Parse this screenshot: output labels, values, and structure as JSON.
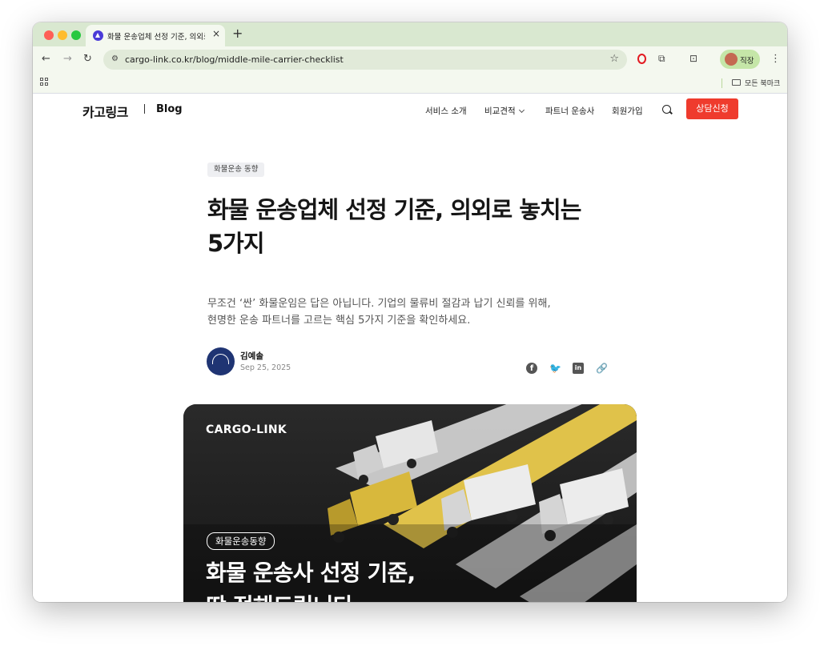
{
  "browser": {
    "tab_title": "화물 운송업체 선정 기준, 의외로 놓",
    "tab_close": "×",
    "new_tab": "+",
    "url": "cargo-link.co.kr/blog/middle-mile-carrier-checklist",
    "profile_name": "직장",
    "bookmarks_folder": "모든 북마크",
    "icons": {
      "back": "←",
      "forward": "→",
      "reload": "↻",
      "site_info": "⚙",
      "star": "☆",
      "extensions": "⧉",
      "cast": "⊡",
      "menu": "⋮"
    }
  },
  "site": {
    "brand": "카고링크",
    "blog_label": "Blog",
    "nav": [
      "서비스 소개",
      "비교견적",
      "파트너 운송사",
      "회원가입"
    ],
    "cta": "상담신청",
    "accent_color": "#ef3b2d"
  },
  "article": {
    "category": "화물운송 동향",
    "title_line1": "화물 운송업체 선정 기준, 의외로 놓치는",
    "title_line2": "5가지",
    "subtitle_line1": "무조건 ‘싼’ 화물운임은 답은 아닙니다. 기업의 물류비 절감과 납기 신뢰를 위해,",
    "subtitle_line2": "현명한 운송 파트너를 고르는 핵심 5가지 기준을 확인하세요.",
    "author": "김예솔",
    "date": "Sep 25, 2025",
    "share": {
      "facebook": "f",
      "twitter": "🐦",
      "linkedin": "in",
      "link": "🔗"
    }
  },
  "hero": {
    "brand": "CARGO-LINK",
    "tag": "화물운송동향",
    "headline_line1": "화물 운송사 선정 기준,",
    "headline_line2": "딱 정해드립니다."
  }
}
